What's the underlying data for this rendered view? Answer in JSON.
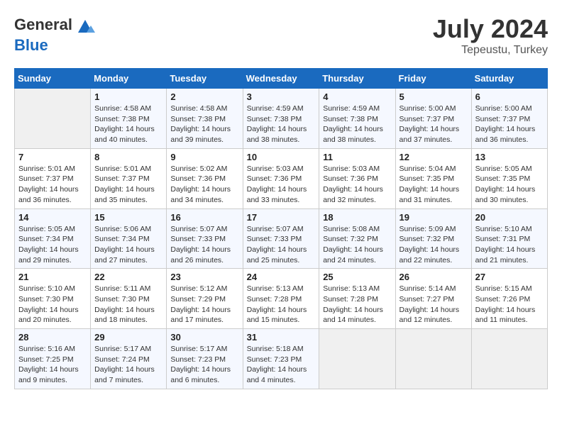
{
  "header": {
    "logo_line1": "General",
    "logo_line2": "Blue",
    "title": "July 2024",
    "location": "Tepeustu, Turkey"
  },
  "days_of_week": [
    "Sunday",
    "Monday",
    "Tuesday",
    "Wednesday",
    "Thursday",
    "Friday",
    "Saturday"
  ],
  "weeks": [
    [
      {
        "day": "",
        "info": ""
      },
      {
        "day": "1",
        "info": "Sunrise: 4:58 AM\nSunset: 7:38 PM\nDaylight: 14 hours\nand 40 minutes."
      },
      {
        "day": "2",
        "info": "Sunrise: 4:58 AM\nSunset: 7:38 PM\nDaylight: 14 hours\nand 39 minutes."
      },
      {
        "day": "3",
        "info": "Sunrise: 4:59 AM\nSunset: 7:38 PM\nDaylight: 14 hours\nand 38 minutes."
      },
      {
        "day": "4",
        "info": "Sunrise: 4:59 AM\nSunset: 7:38 PM\nDaylight: 14 hours\nand 38 minutes."
      },
      {
        "day": "5",
        "info": "Sunrise: 5:00 AM\nSunset: 7:37 PM\nDaylight: 14 hours\nand 37 minutes."
      },
      {
        "day": "6",
        "info": "Sunrise: 5:00 AM\nSunset: 7:37 PM\nDaylight: 14 hours\nand 36 minutes."
      }
    ],
    [
      {
        "day": "7",
        "info": "Sunrise: 5:01 AM\nSunset: 7:37 PM\nDaylight: 14 hours\nand 36 minutes."
      },
      {
        "day": "8",
        "info": "Sunrise: 5:01 AM\nSunset: 7:37 PM\nDaylight: 14 hours\nand 35 minutes."
      },
      {
        "day": "9",
        "info": "Sunrise: 5:02 AM\nSunset: 7:36 PM\nDaylight: 14 hours\nand 34 minutes."
      },
      {
        "day": "10",
        "info": "Sunrise: 5:03 AM\nSunset: 7:36 PM\nDaylight: 14 hours\nand 33 minutes."
      },
      {
        "day": "11",
        "info": "Sunrise: 5:03 AM\nSunset: 7:36 PM\nDaylight: 14 hours\nand 32 minutes."
      },
      {
        "day": "12",
        "info": "Sunrise: 5:04 AM\nSunset: 7:35 PM\nDaylight: 14 hours\nand 31 minutes."
      },
      {
        "day": "13",
        "info": "Sunrise: 5:05 AM\nSunset: 7:35 PM\nDaylight: 14 hours\nand 30 minutes."
      }
    ],
    [
      {
        "day": "14",
        "info": "Sunrise: 5:05 AM\nSunset: 7:34 PM\nDaylight: 14 hours\nand 29 minutes."
      },
      {
        "day": "15",
        "info": "Sunrise: 5:06 AM\nSunset: 7:34 PM\nDaylight: 14 hours\nand 27 minutes."
      },
      {
        "day": "16",
        "info": "Sunrise: 5:07 AM\nSunset: 7:33 PM\nDaylight: 14 hours\nand 26 minutes."
      },
      {
        "day": "17",
        "info": "Sunrise: 5:07 AM\nSunset: 7:33 PM\nDaylight: 14 hours\nand 25 minutes."
      },
      {
        "day": "18",
        "info": "Sunrise: 5:08 AM\nSunset: 7:32 PM\nDaylight: 14 hours\nand 24 minutes."
      },
      {
        "day": "19",
        "info": "Sunrise: 5:09 AM\nSunset: 7:32 PM\nDaylight: 14 hours\nand 22 minutes."
      },
      {
        "day": "20",
        "info": "Sunrise: 5:10 AM\nSunset: 7:31 PM\nDaylight: 14 hours\nand 21 minutes."
      }
    ],
    [
      {
        "day": "21",
        "info": "Sunrise: 5:10 AM\nSunset: 7:30 PM\nDaylight: 14 hours\nand 20 minutes."
      },
      {
        "day": "22",
        "info": "Sunrise: 5:11 AM\nSunset: 7:30 PM\nDaylight: 14 hours\nand 18 minutes."
      },
      {
        "day": "23",
        "info": "Sunrise: 5:12 AM\nSunset: 7:29 PM\nDaylight: 14 hours\nand 17 minutes."
      },
      {
        "day": "24",
        "info": "Sunrise: 5:13 AM\nSunset: 7:28 PM\nDaylight: 14 hours\nand 15 minutes."
      },
      {
        "day": "25",
        "info": "Sunrise: 5:13 AM\nSunset: 7:28 PM\nDaylight: 14 hours\nand 14 minutes."
      },
      {
        "day": "26",
        "info": "Sunrise: 5:14 AM\nSunset: 7:27 PM\nDaylight: 14 hours\nand 12 minutes."
      },
      {
        "day": "27",
        "info": "Sunrise: 5:15 AM\nSunset: 7:26 PM\nDaylight: 14 hours\nand 11 minutes."
      }
    ],
    [
      {
        "day": "28",
        "info": "Sunrise: 5:16 AM\nSunset: 7:25 PM\nDaylight: 14 hours\nand 9 minutes."
      },
      {
        "day": "29",
        "info": "Sunrise: 5:17 AM\nSunset: 7:24 PM\nDaylight: 14 hours\nand 7 minutes."
      },
      {
        "day": "30",
        "info": "Sunrise: 5:17 AM\nSunset: 7:23 PM\nDaylight: 14 hours\nand 6 minutes."
      },
      {
        "day": "31",
        "info": "Sunrise: 5:18 AM\nSunset: 7:23 PM\nDaylight: 14 hours\nand 4 minutes."
      },
      {
        "day": "",
        "info": ""
      },
      {
        "day": "",
        "info": ""
      },
      {
        "day": "",
        "info": ""
      }
    ]
  ]
}
